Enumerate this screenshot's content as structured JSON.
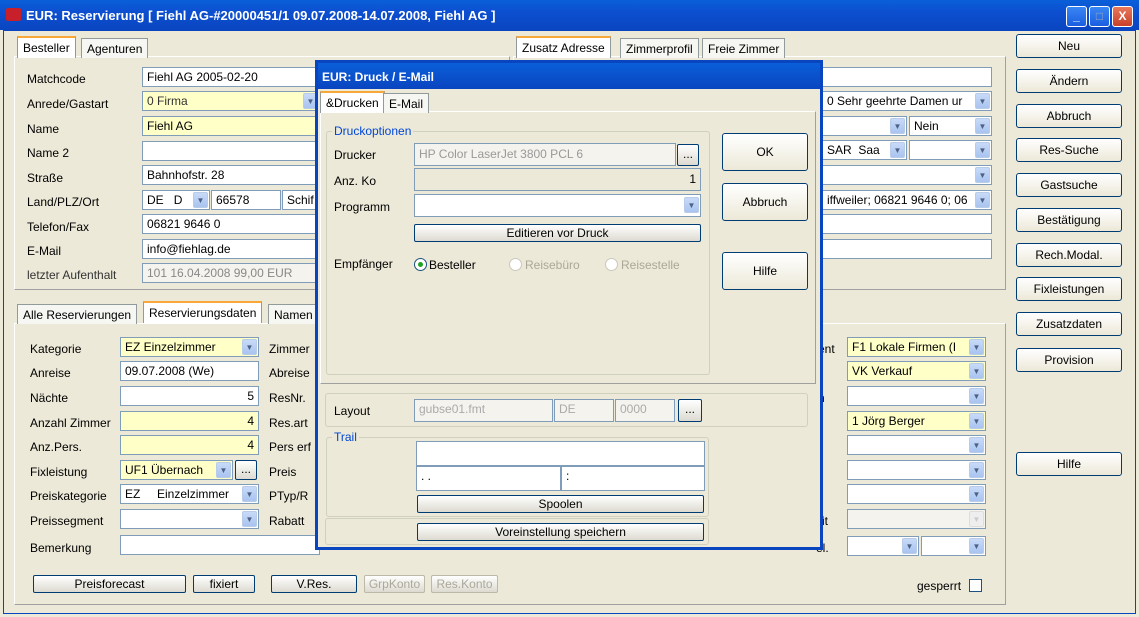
{
  "window": {
    "title": "EUR: Reservierung [ Fiehl AG-#20000451/1 09.07.2008-14.07.2008, Fiehl AG ]",
    "btn_min": "_",
    "btn_max": "□",
    "btn_close": "X"
  },
  "top_tabs_left": [
    "Besteller",
    "Agenturen"
  ],
  "top_tabs_right": [
    "Zusatz Adresse",
    "Zimmerprofil",
    "Freie Zimmer"
  ],
  "guest": {
    "matchcode_label": "Matchcode",
    "matchcode": "Fiehl AG 2005-02-20",
    "anrede_label": "Anrede/Gastart",
    "anrede": "0 Firma",
    "name_label": "Name",
    "name": "Fiehl AG",
    "name2_label": "Name 2",
    "name2": "",
    "strasse_label": "Straße",
    "strasse": "Bahnhofstr. 28",
    "land_label": "Land/PLZ/Ort",
    "land": "DE",
    "land2": "D",
    "plz": "66578",
    "ort": "Schif",
    "telefon_label": "Telefon/Fax",
    "telefon": "06821 9646 0",
    "email_label": "E-Mail",
    "email": "info@fiehlag.de",
    "aufenthalt_label": "letzter Aufenthalt",
    "aufenthalt": "101 16.04.2008 99,00 EUR"
  },
  "right_addr": {
    "anrede": "0 Sehr geehrte Damen ur",
    "nein": "Nein",
    "sar": "SAR",
    "saa": "Saa",
    "ort_tel": "iffweiler; 06821 9646 0; 06"
  },
  "sidebar": [
    "Neu",
    "Ändern",
    "Abbruch",
    "Res-Suche",
    "Gastsuche",
    "Bestätigung",
    "Rech.Modal.",
    "Fixleistungen",
    "Zusatzdaten",
    "Provision"
  ],
  "hilfe": "Hilfe",
  "bottom_tabs": [
    "Alle Reservierungen",
    "Reservierungsdaten",
    "Namen"
  ],
  "res": {
    "kategorie_label": "Kategorie",
    "kategorie": "EZ  Einzelzimmer",
    "anreise_label": "Anreise",
    "anreise": "09.07.2008 (We)",
    "naechte_label": "Nächte",
    "naechte": "5",
    "anzahl_label": "Anzahl Zimmer",
    "anzahl": "4",
    "pers_label": "Anz.Pers.",
    "pers": "4",
    "fix_label": "Fixleistung",
    "fix": "UF1  Übernach",
    "preiskat_label": "Preiskategorie",
    "preiskat_code": "EZ",
    "preiskat": "Einzelzimmer",
    "preisseg_label": "Preissegment",
    "bemerkung_label": "Bemerkung",
    "mid_labels": [
      "Zimmer",
      "Abreise",
      "ResNr.",
      "Res.art",
      "Pers erf",
      "Preis",
      "PTyp/R",
      "Rabatt"
    ],
    "ent_label": "ent",
    "segment1": "F1  Lokale Firmen (I",
    "segment2": "VK   Verkauf",
    "bearbeiter": "1 Jörg Berger",
    "n_label": "n",
    "it_label": "it",
    "el_label": "el.",
    "gesperrt": "gesperrt"
  },
  "bottom_buttons": [
    "Preisforecast",
    "fixiert",
    "V.Res.",
    "GrpKonto",
    "Res.Konto"
  ],
  "dialog": {
    "title": "EUR: Druck / E-Mail",
    "tabs": [
      "&Drucken",
      "E-Mail"
    ],
    "group_label": "Druckoptionen",
    "drucker_label": "Drucker",
    "drucker": "HP Color LaserJet 3800 PCL 6",
    "anz_label": "Anz. Ko",
    "anz": "1",
    "programm_label": "Programm",
    "editieren": "Editieren vor Druck",
    "empfaenger_label": "Empfänger",
    "empf_options": [
      "Besteller",
      "Reisebüro",
      "Reisestelle"
    ],
    "ok": "OK",
    "abbruch": "Abbruch",
    "hilfe": "Hilfe",
    "layout_label": "Layout",
    "layout": "gubse01.fmt",
    "layout_lang": "DE",
    "layout_num": "0000",
    "trail_label": "Trail",
    "trail_date": ".  .",
    "trail_time": ":",
    "spoolen": "Spoolen",
    "voreinstellung": "Voreinstellung speichern",
    "ellipsis": "..."
  }
}
